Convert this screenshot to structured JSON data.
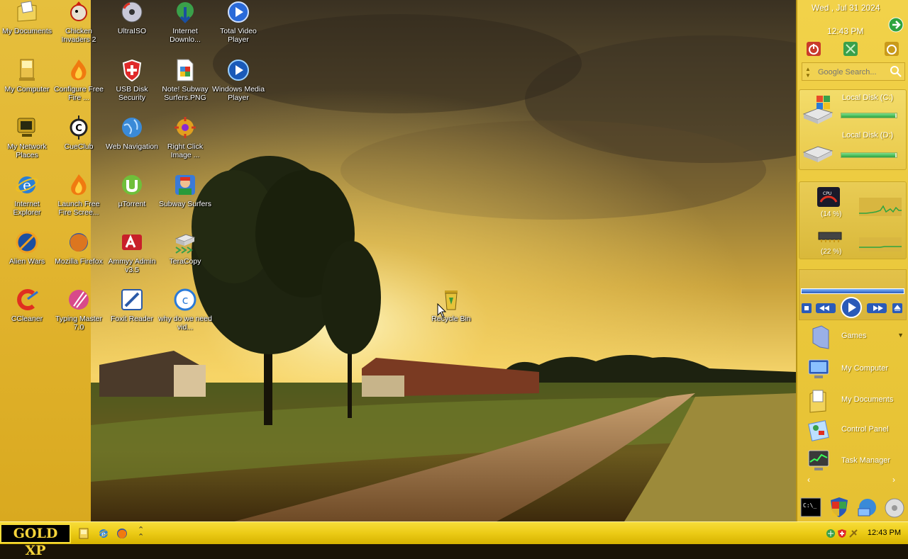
{
  "desktop_icons": [
    {
      "label": "My Documents",
      "icon": "my-documents-icon"
    },
    {
      "label": "Chicken Invaders 2",
      "icon": "chicken-invaders-icon"
    },
    {
      "label": "UltraISO",
      "icon": "ultraiso-icon"
    },
    {
      "label": "Internet Downlo...",
      "icon": "internet-download-manager-icon"
    },
    {
      "label": "Total Video Player",
      "icon": "total-video-player-icon"
    },
    {
      "label": "My Computer",
      "icon": "my-computer-icon"
    },
    {
      "label": "Configure Free Fire ...",
      "icon": "free-fire-icon"
    },
    {
      "label": "USB Disk Security",
      "icon": "usb-disk-security-icon"
    },
    {
      "label": "Note! Subway Surfers.PNG",
      "icon": "png-file-icon"
    },
    {
      "label": "Windows Media Player",
      "icon": "windows-media-player-icon"
    },
    {
      "label": "My Network Places",
      "icon": "network-places-icon"
    },
    {
      "label": "CueClub",
      "icon": "cueclub-icon"
    },
    {
      "label": "Web Navigation",
      "icon": "globe-icon"
    },
    {
      "label": "Right Click Image ...",
      "icon": "right-click-image-icon"
    },
    {
      "label": "Internet Explorer",
      "icon": "internet-explorer-icon"
    },
    {
      "label": "Launch Free Fire Scree...",
      "icon": "free-fire-icon"
    },
    {
      "label": "µTorrent",
      "icon": "utorrent-icon"
    },
    {
      "label": "Subway Surfers",
      "icon": "subway-surfers-icon"
    },
    {
      "label": "Alien Wars",
      "icon": "alien-wars-icon"
    },
    {
      "label": "Mozilla Firefox",
      "icon": "firefox-icon"
    },
    {
      "label": "Ammyy Admin v3.5",
      "icon": "ammyy-admin-icon"
    },
    {
      "label": "TeraCopy",
      "icon": "teracopy-icon"
    },
    {
      "label": "CCleaner",
      "icon": "ccleaner-icon"
    },
    {
      "label": "Typing Master 7.0",
      "icon": "typing-master-icon"
    },
    {
      "label": "Foxit Reader",
      "icon": "foxit-reader-icon"
    },
    {
      "label": "why do we need vid...",
      "icon": "shortcut-icon"
    },
    {
      "label": "Recycle Bin",
      "icon": "recycle-bin-icon"
    }
  ],
  "sidebar": {
    "date": "Wed , Jul 31 2024",
    "time": "12:43 PM",
    "search_placeholder": "Google Search...",
    "disks": [
      {
        "label": "Local Disk (C:)",
        "used": 0.98
      },
      {
        "label": "Local Disk (D:)",
        "used": 0.98
      }
    ],
    "cpu_percent": "(14 %)",
    "ram_percent": "(22 %)",
    "menu": [
      {
        "label": "Games",
        "icon": "games-folder-icon"
      },
      {
        "label": "My Computer",
        "icon": "my-computer-icon"
      },
      {
        "label": "My Documents",
        "icon": "my-documents-icon"
      },
      {
        "label": "Control Panel",
        "icon": "control-panel-icon"
      },
      {
        "label": "Task Manager",
        "icon": "task-manager-icon"
      }
    ]
  },
  "taskbar": {
    "start_label": "GOLD XP",
    "clock": "12:43 PM"
  }
}
